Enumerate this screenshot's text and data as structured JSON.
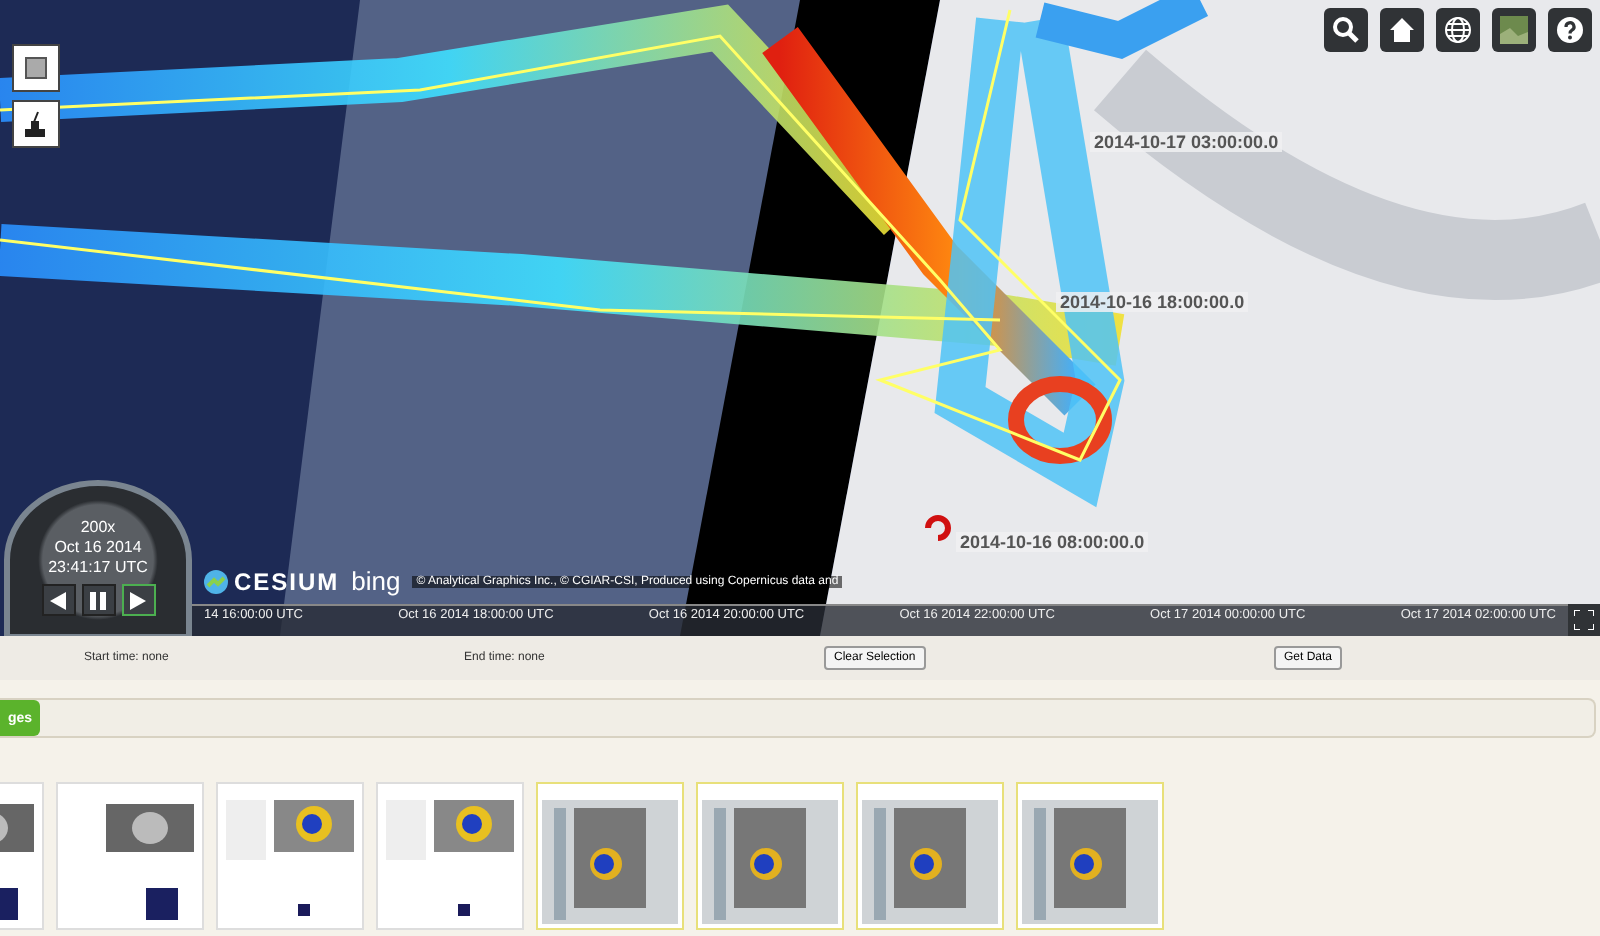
{
  "map": {
    "labels": [
      {
        "text": "2014-10-17 03:00:00.0"
      },
      {
        "text": "2014-10-16 18:00:00.0"
      },
      {
        "text": "2014-10-16 08:00:00.0"
      }
    ],
    "left_tools": [
      {
        "kind": "square"
      },
      {
        "kind": "draw"
      }
    ],
    "toolbar": [
      {
        "kind": "search"
      },
      {
        "kind": "home"
      },
      {
        "kind": "globe"
      },
      {
        "kind": "imagery"
      },
      {
        "kind": "help"
      }
    ],
    "logo": "CESIUM",
    "bing": "bing",
    "credits": "© Analytical Graphics Inc., © CGIAR-CSI, Produced using Copernicus data and"
  },
  "clock": {
    "speed": "200x",
    "date": "Oct 16 2014",
    "time": "23:41:17 UTC",
    "buttons": [
      {
        "kind": "back",
        "selected": false
      },
      {
        "kind": "pause",
        "selected": false
      },
      {
        "kind": "play",
        "selected": true
      }
    ]
  },
  "timeline": {
    "ticks": [
      "14 16:00:00 UTC",
      "Oct 16 2014 18:00:00 UTC",
      "Oct 16 2014 20:00:00 UTC",
      "Oct 16 2014 22:00:00 UTC",
      "Oct 17 2014 00:00:00 UTC",
      "Oct 17 2014 02:00:00 UTC"
    ]
  },
  "selection": {
    "start": "Start time: none",
    "end": "End time: none",
    "buttons": [
      "Clear Selection",
      "Get Data"
    ]
  },
  "tab": {
    "label": "ges"
  },
  "thumbnails": [
    {
      "kind": "grey-page",
      "selected": false
    },
    {
      "kind": "grey-page",
      "selected": false
    },
    {
      "kind": "color-page",
      "selected": false
    },
    {
      "kind": "color-page",
      "selected": false
    },
    {
      "kind": "viewer",
      "selected": true
    },
    {
      "kind": "viewer",
      "selected": true
    },
    {
      "kind": "viewer",
      "selected": true
    },
    {
      "kind": "viewer",
      "selected": true
    }
  ]
}
